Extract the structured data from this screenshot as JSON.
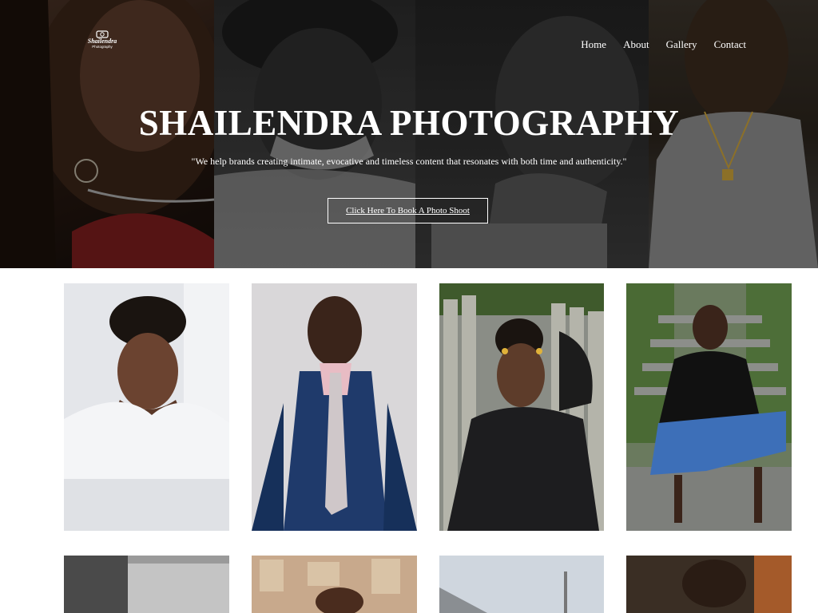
{
  "logo": {
    "main": "Shailendra",
    "sub": "Photography",
    "icon": "camera-icon"
  },
  "nav": [
    {
      "label": "Home"
    },
    {
      "label": "About"
    },
    {
      "label": "Gallery"
    },
    {
      "label": "Contact"
    }
  ],
  "hero": {
    "title": "SHAILENDRA PHOTOGRAPHY",
    "tagline": "\"We help brands creating intimate, evocative and timeless content that resonates with both time and authenticity.\"",
    "cta_label": "Click Here To Book A Photo Shoot"
  },
  "colors": {
    "hero_text": "#ffffff",
    "page_background": "#ffffff",
    "button_border": "#ffffff"
  }
}
